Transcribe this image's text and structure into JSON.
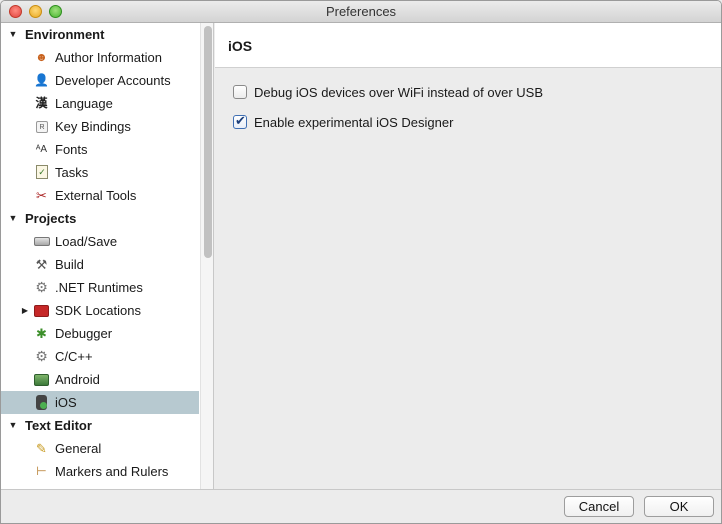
{
  "window": {
    "title": "Preferences"
  },
  "sidebar": {
    "sections": [
      {
        "label": "Environment",
        "items": [
          {
            "label": "Author Information",
            "icon": "author-icon"
          },
          {
            "label": "Developer Accounts",
            "icon": "person-icon"
          },
          {
            "label": "Language",
            "icon": "kanji-icon",
            "glyph": "漢"
          },
          {
            "label": "Key Bindings",
            "icon": "keyboard-key-icon",
            "glyph": "R"
          },
          {
            "label": "Fonts",
            "icon": "fonts-icon",
            "glyph": "ᴬA"
          },
          {
            "label": "Tasks",
            "icon": "tasks-checklist-icon",
            "glyph": "✓"
          },
          {
            "label": "External Tools",
            "icon": "tools-icon",
            "glyph": "✂"
          }
        ]
      },
      {
        "label": "Projects",
        "items": [
          {
            "label": "Load/Save",
            "icon": "disk-icon"
          },
          {
            "label": "Build",
            "icon": "hammer-icon",
            "glyph": "🔨"
          },
          {
            "label": ".NET Runtimes",
            "icon": "gear-icon",
            "glyph": "⚙"
          },
          {
            "label": "SDK Locations",
            "icon": "toolbox-icon"
          },
          {
            "label": "Debugger",
            "icon": "bug-icon",
            "glyph": "✱"
          },
          {
            "label": "C/C++",
            "icon": "gear-icon",
            "glyph": "⚙"
          },
          {
            "label": "Android",
            "icon": "android-icon"
          },
          {
            "label": "iOS",
            "icon": "ios-device-icon"
          }
        ]
      },
      {
        "label": "Text Editor",
        "items": [
          {
            "label": "General",
            "icon": "pencil-note-icon",
            "glyph": "✎"
          },
          {
            "label": "Markers and Rulers",
            "icon": "ruler-icon",
            "glyph": "⊢"
          }
        ]
      }
    ]
  },
  "main": {
    "title": "iOS",
    "options": [
      {
        "label": "Debug iOS devices over WiFi instead of over USB",
        "checked": false
      },
      {
        "label": "Enable experimental iOS Designer",
        "checked": true
      }
    ]
  },
  "buttons": {
    "cancel": "Cancel",
    "ok": "OK"
  },
  "colors": {
    "selection": "#b7c9d0",
    "sidebar_bg": "#ffffff",
    "window_bg": "#ececec"
  }
}
